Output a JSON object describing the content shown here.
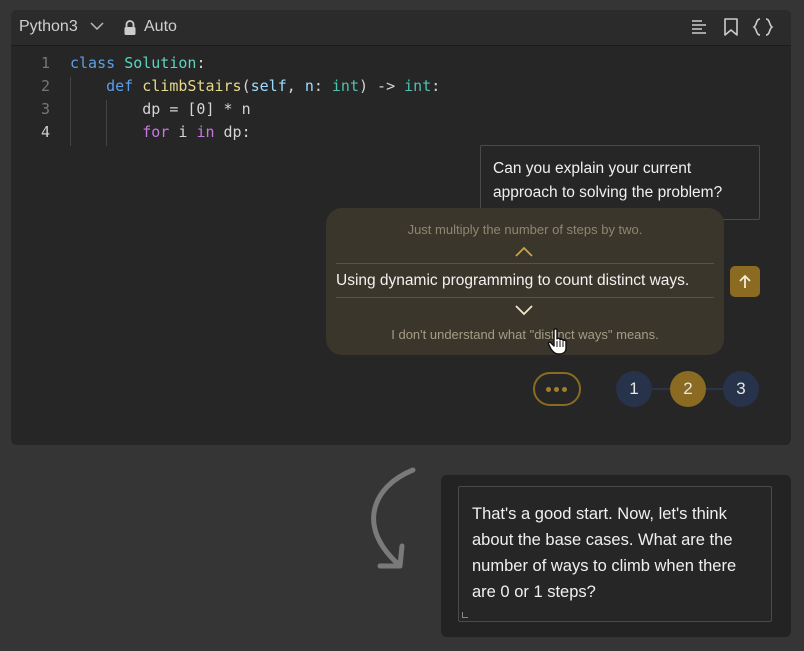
{
  "toolbar": {
    "language": "Python3",
    "mode": "Auto",
    "icons": [
      "chevron-down-icon",
      "lock-icon",
      "format-icon",
      "bookmark-icon",
      "braces-icon"
    ]
  },
  "code": {
    "lines": [
      {
        "number": "1",
        "text": "class Solution:"
      },
      {
        "number": "2",
        "text": "    def climbStairs(self, n: int) -> int:"
      },
      {
        "number": "3",
        "text": "        dp = [0] * n"
      },
      {
        "number": "4",
        "text": "        for i in dp:"
      }
    ],
    "active_line": "4"
  },
  "question": {
    "text": "Can you explain your current approach to solving the problem?"
  },
  "picker": {
    "previous_option": "Just multiply the number of steps by two.",
    "current_option": "Using dynamic programming to count distinct ways.",
    "next_option": "I don't understand what \"distinct ways\" means."
  },
  "steps": {
    "items": [
      "1",
      "2",
      "3"
    ],
    "active": "2"
  },
  "response": {
    "text": "That's a good start. Now, let's think about the base cases. What are the number of ways to climb when there are 0 or 1 steps?"
  },
  "colors": {
    "background": "#353535",
    "panel": "#262626",
    "accent": "#8a6b21",
    "step_inactive": "#26334a"
  }
}
